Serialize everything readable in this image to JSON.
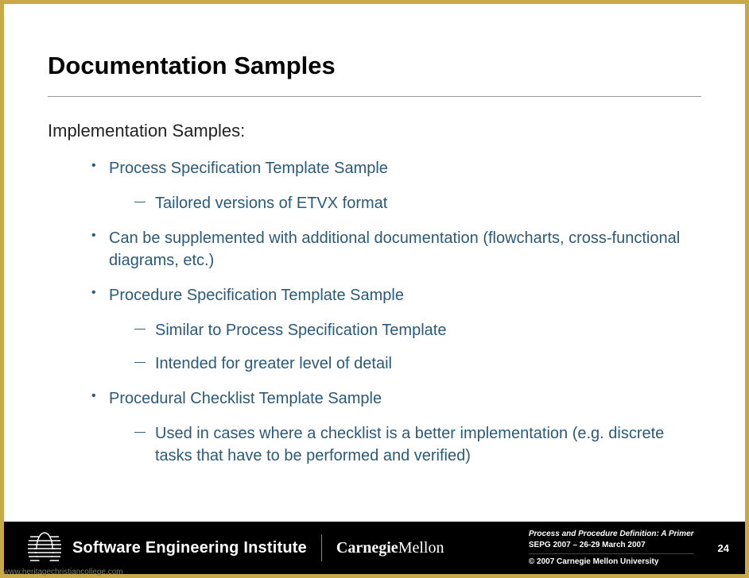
{
  "title": "Documentation Samples",
  "subtitle": "Implementation Samples:",
  "bullets": {
    "b0": "Process Specification Template Sample",
    "b0_s0": "Tailored versions of ETVX format",
    "b1": "Can be supplemented with additional documentation (flowcharts, cross-functional diagrams, etc.)",
    "b2": "Procedure Specification Template Sample",
    "b2_s0": "Similar to Process Specification Template",
    "b2_s1": "Intended for greater level of detail",
    "b3": "Procedural Checklist Template Sample",
    "b3_s0": "Used in cases where a checklist is a better implementation (e.g. discrete tasks that have to be performed and verified)"
  },
  "footer": {
    "sei": "Software Engineering Institute",
    "cmu_bold": "Carnegie",
    "cmu_rest": "Mellon",
    "doc_title": "Process and Procedure Definition: A Primer",
    "conference": "SEPG 2007 – 26-29 March 2007",
    "copyright": "© 2007 Carnegie Mellon University",
    "page_number": "24"
  },
  "watermark": "www.heritagechristiancollege.com"
}
